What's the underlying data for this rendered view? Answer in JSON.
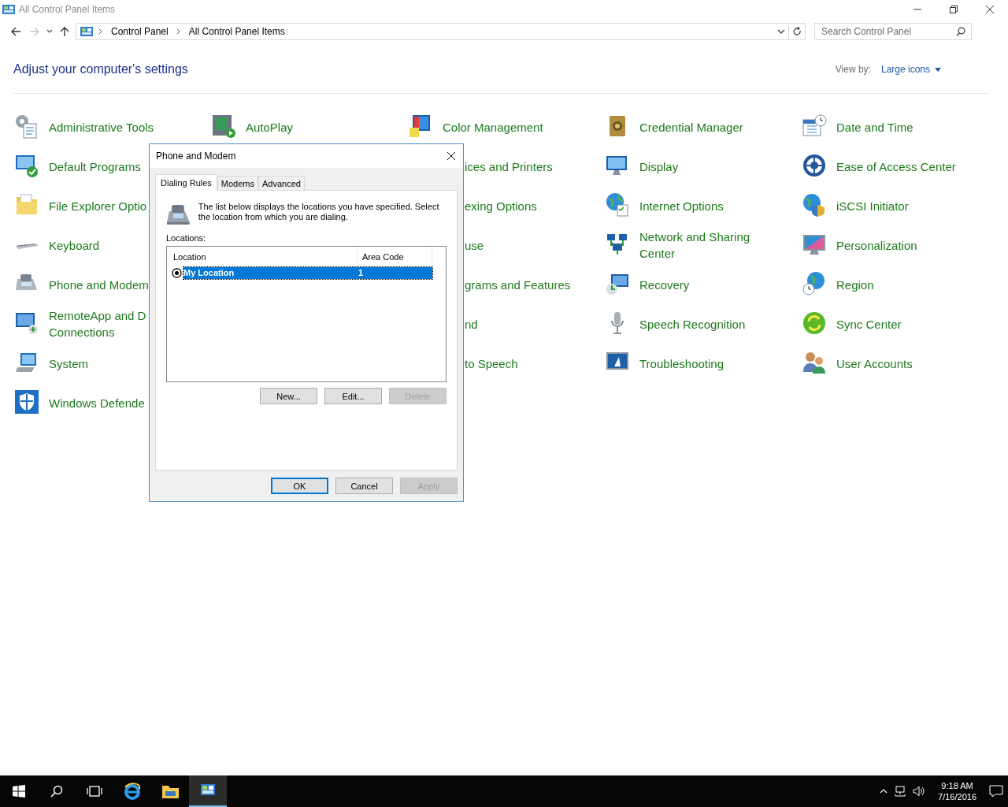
{
  "window": {
    "title": "All Control Panel Items"
  },
  "address_bar": {
    "crumbs": [
      "Control Panel",
      "All Control Panel Items"
    ]
  },
  "search": {
    "placeholder": "Search Control Panel"
  },
  "header": {
    "title": "Adjust your computer's settings",
    "view_by_label": "View by:",
    "view_by_value": "Large icons"
  },
  "columns": [
    [
      {
        "label": "Administrative Tools",
        "covered_left": false
      },
      {
        "label": "Default Programs",
        "covered_left": false
      },
      {
        "label": "File Explorer Optio",
        "covered_left": false
      },
      {
        "label": "Keyboard",
        "covered_left": false
      },
      {
        "label": "Phone and Modem",
        "covered_left": false
      },
      {
        "label": "RemoteApp and D\nConnections",
        "covered_left": false
      },
      {
        "label": "System",
        "covered_left": false
      },
      {
        "label": "Windows Defende",
        "covered_left": false
      }
    ],
    [
      {
        "label": "AutoPlay",
        "covered_left": false
      }
    ],
    [
      {
        "label": "Color Management",
        "covered_left": false
      },
      {
        "label": "ices and Printers",
        "covered_left": true
      },
      {
        "label": "exing Options",
        "covered_left": true
      },
      {
        "label": "use",
        "covered_left": true
      },
      {
        "label": "grams and Features",
        "covered_left": true
      },
      {
        "label": "nd",
        "covered_left": true
      },
      {
        "label": "to Speech",
        "covered_left": true
      }
    ],
    [
      {
        "label": "Credential Manager",
        "covered_left": false
      },
      {
        "label": "Display",
        "covered_left": false
      },
      {
        "label": "Internet Options",
        "covered_left": false
      },
      {
        "label": "Network and Sharing\nCenter",
        "covered_left": false
      },
      {
        "label": "Recovery",
        "covered_left": false
      },
      {
        "label": "Speech Recognition",
        "covered_left": false
      },
      {
        "label": "Troubleshooting",
        "covered_left": false
      }
    ],
    [
      {
        "label": "Date and Time",
        "covered_left": false
      },
      {
        "label": "Ease of Access Center",
        "covered_left": false
      },
      {
        "label": "iSCSI Initiator",
        "covered_left": false
      },
      {
        "label": "Personalization",
        "covered_left": false
      },
      {
        "label": "Region",
        "covered_left": false
      },
      {
        "label": "Sync Center",
        "covered_left": false
      },
      {
        "label": "User Accounts",
        "covered_left": false
      }
    ]
  ],
  "dialog": {
    "title": "Phone and Modem",
    "tabs": [
      {
        "label": "Dialing Rules",
        "selected": true
      },
      {
        "label": "Modems",
        "selected": false
      },
      {
        "label": "Advanced",
        "selected": false
      }
    ],
    "description": "The list below displays the locations you have specified. Select the location from which you are dialing.",
    "list_label": "Locations:",
    "list": {
      "columns": [
        "Location",
        "Area Code"
      ],
      "rows": [
        {
          "location": "My Location",
          "area_code": "1",
          "selected": true,
          "current": true
        }
      ]
    },
    "list_buttons": [
      {
        "label": "New...",
        "disabled": false
      },
      {
        "label": "Edit...",
        "disabled": false
      },
      {
        "label": "Delete",
        "disabled": true
      }
    ],
    "buttons": [
      {
        "label": "OK",
        "disabled": false,
        "default": true
      },
      {
        "label": "Cancel",
        "disabled": false,
        "default": false
      },
      {
        "label": "Apply",
        "disabled": true,
        "default": false
      }
    ]
  },
  "taskbar": {
    "apps": [
      {
        "selected": false
      },
      {
        "selected": false
      },
      {
        "selected": true
      }
    ],
    "time": "9:18 AM",
    "date": "7/16/2016"
  }
}
